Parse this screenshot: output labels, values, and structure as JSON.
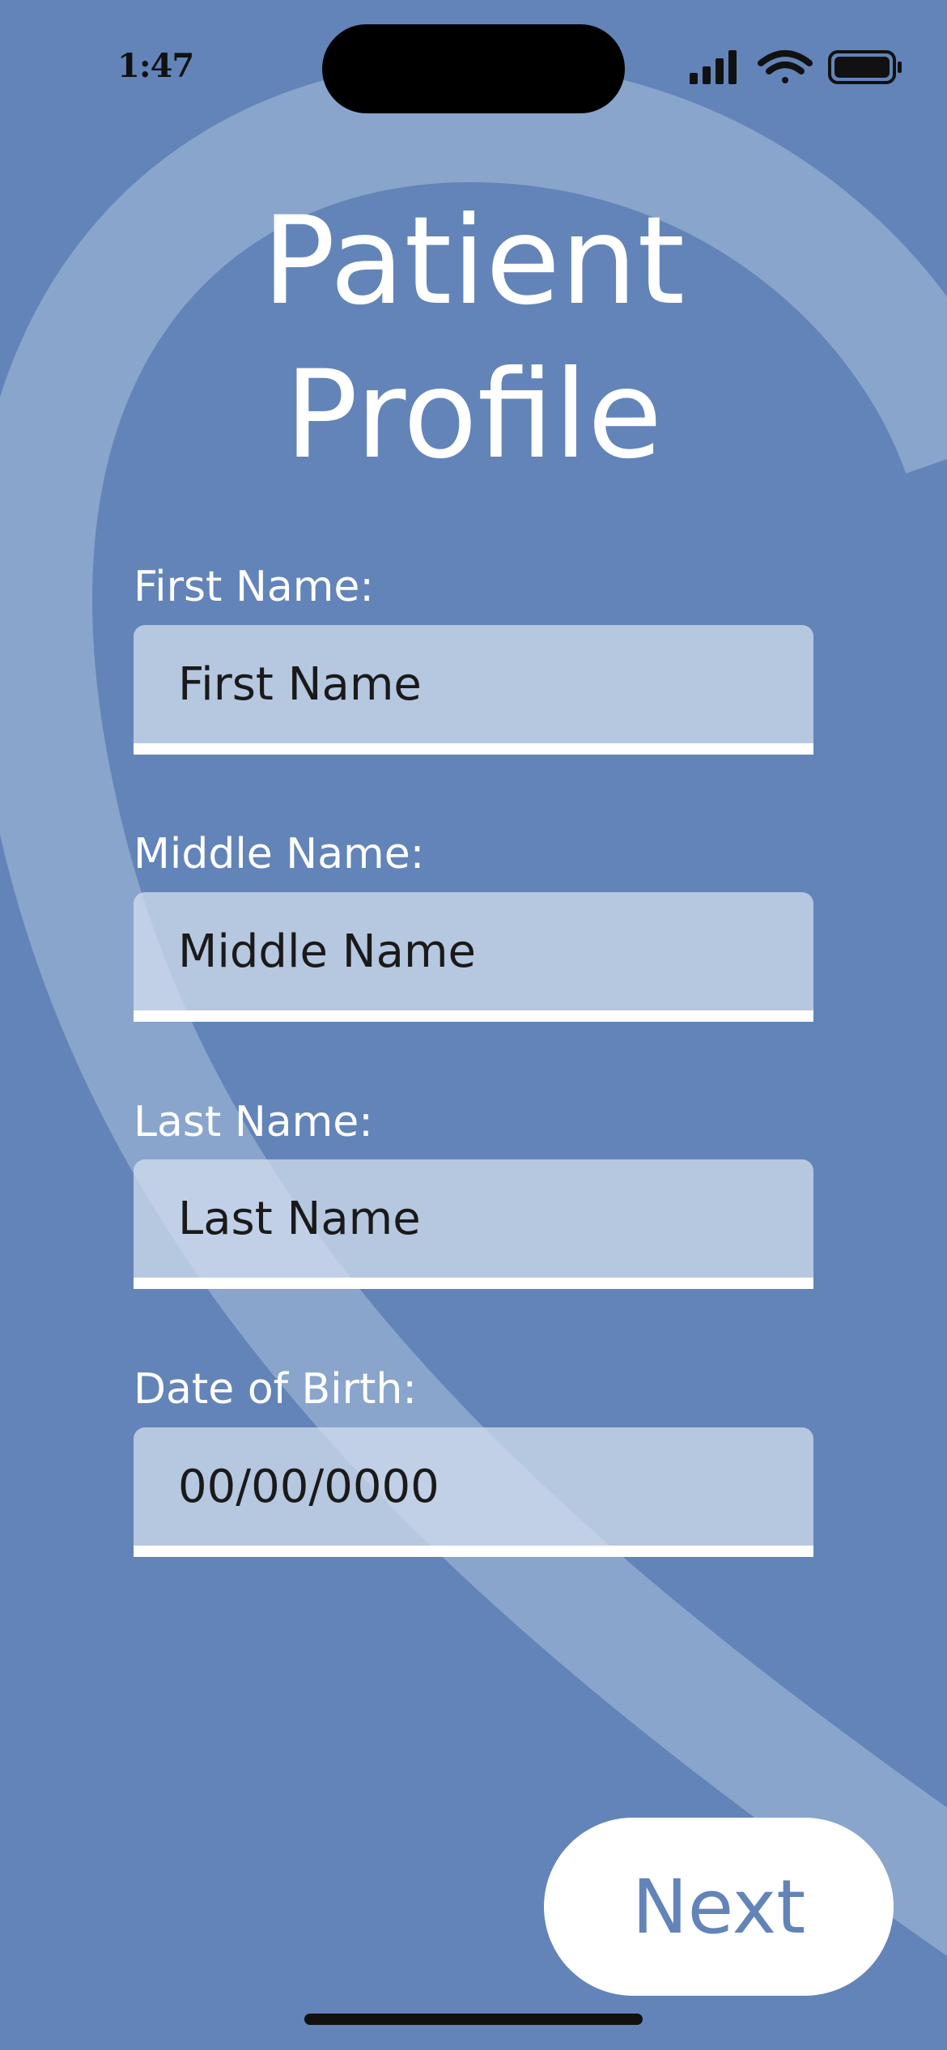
{
  "status_bar": {
    "time": "1:47",
    "icons": [
      "cellular-signal-icon",
      "wifi-icon",
      "battery-icon"
    ]
  },
  "page": {
    "title": "Patient Profile"
  },
  "form": {
    "fields": [
      {
        "label": "First Name:",
        "placeholder": "First Name",
        "value": ""
      },
      {
        "label": "Middle Name:",
        "placeholder": "Middle Name",
        "value": ""
      },
      {
        "label": "Last Name:",
        "placeholder": "Last Name",
        "value": ""
      },
      {
        "label": "Date of Birth:",
        "placeholder": "00/00/0000",
        "value": ""
      }
    ]
  },
  "actions": {
    "next_label": "Next"
  },
  "colors": {
    "background": "#6384b8",
    "ribbon": "#8aa5cb",
    "field_fill": "#c1cde1",
    "text_light": "#ffffff",
    "text_dark": "#1a1a1a"
  }
}
